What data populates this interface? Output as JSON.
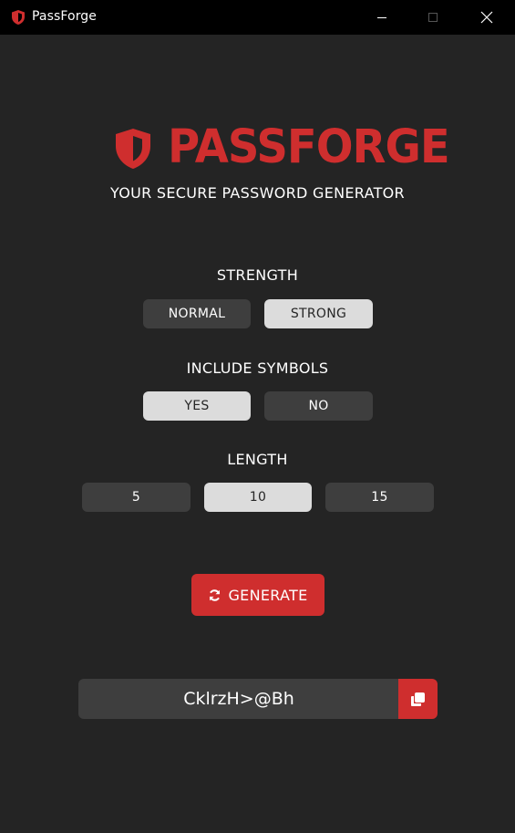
{
  "window": {
    "title": "PassForge",
    "minimize_icon": "minimize-icon",
    "maximize_icon": "maximize-icon",
    "close_icon": "close-icon"
  },
  "header": {
    "brand": "PASSFORGE",
    "subtitle": "YOUR SECURE PASSWORD GENERATOR",
    "logo_icon": "shield-icon"
  },
  "strength": {
    "title": "STRENGTH",
    "options": [
      {
        "label": "NORMAL",
        "selected": false
      },
      {
        "label": "STRONG",
        "selected": true
      }
    ]
  },
  "symbols": {
    "title": "INCLUDE SYMBOLS",
    "options": [
      {
        "label": "YES",
        "selected": true
      },
      {
        "label": "NO",
        "selected": false
      }
    ]
  },
  "length": {
    "title": "LENGTH",
    "options": [
      {
        "label": "5",
        "selected": false
      },
      {
        "label": "10",
        "selected": true
      },
      {
        "label": "15",
        "selected": false
      }
    ]
  },
  "generate": {
    "label": "GENERATE",
    "icon": "refresh-icon"
  },
  "output": {
    "password": "CklrzH>@Bh",
    "copy_icon": "copy-icon"
  },
  "colors": {
    "accent": "#cf2e2e",
    "background": "#242424",
    "button_off": "#3e3e3e",
    "button_on": "#dcdcdc"
  }
}
